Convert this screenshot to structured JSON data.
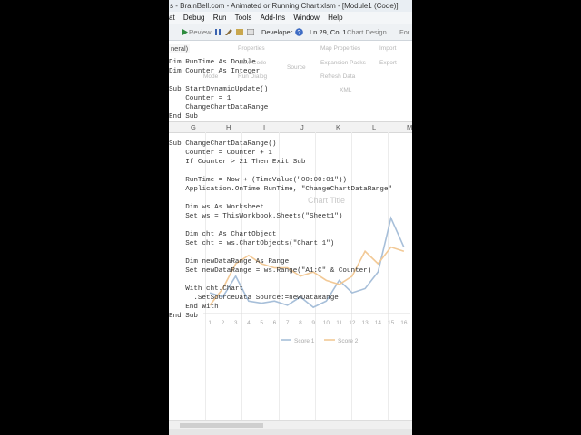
{
  "window": {
    "title": "s - BrainBell.com - Animated or Running Chart.xlsm - [Module1 (Code)]"
  },
  "menu": [
    "at",
    "Debug",
    "Run",
    "Tools",
    "Add-Ins",
    "Window",
    "Help"
  ],
  "toolbar": {
    "review_tab": "Review",
    "developer_tab": "Developer",
    "chart_design_tab": "Chart Design",
    "format_tab": "For",
    "cursor_pos": "Ln 29, Col 1"
  },
  "ribbon_ghost": [
    "Properties",
    "View Code",
    "Map Properties",
    "Import",
    "Mode",
    "Run Dialog",
    "Expansion Packs",
    "Export",
    "Source",
    "Refresh Data",
    "XML"
  ],
  "object_box": "neral)",
  "code_top": [
    "Dim RunTime As Double",
    "Dim Counter As Integer",
    "",
    "Sub StartDynamicUpdate()",
    "    Counter = 1",
    "    ChangeChartDataRange",
    "End Sub"
  ],
  "columns": [
    "G",
    "H",
    "I",
    "J",
    "K",
    "L",
    "M"
  ],
  "code_bottom": [
    "Sub ChangeChartDataRange()",
    "    Counter = Counter + 1",
    "    If Counter > 21 Then Exit Sub",
    "",
    "    RunTime = Now + (TimeValue(\"00:00:01\"))",
    "    Application.OnTime RunTime, \"ChangeChartDataRange\"",
    "",
    "    Dim ws As Worksheet",
    "    Set ws = ThisWorkbook.Sheets(\"Sheet1\")",
    "",
    "    Dim cht As ChartObject",
    "    Set cht = ws.ChartObjects(\"Chart 1\")",
    "",
    "    Dim newDataRange As Range",
    "    Set newDataRange = ws.Range(\"A1:C\" & Counter)",
    "",
    "    With cht.Chart",
    "      .SetSourceData Source:=newDataRange",
    "    End With",
    "End Sub"
  ],
  "chart_data": {
    "type": "line",
    "title": "Chart Title",
    "x": [
      1,
      2,
      3,
      4,
      5,
      6,
      7,
      8,
      9,
      10,
      11,
      12,
      13,
      14,
      15,
      16
    ],
    "series": [
      {
        "name": "Score 1",
        "color": "#a7bfd9",
        "values": [
          5,
          4,
          9,
          3,
          2.5,
          3,
          2,
          4,
          1.5,
          3,
          8,
          5,
          6,
          10,
          23,
          16
        ]
      },
      {
        "name": "Score 2",
        "color": "#f2c996",
        "values": [
          2,
          6,
          12,
          14,
          12,
          11,
          11,
          9,
          10,
          8,
          7,
          9,
          15,
          12,
          16,
          15
        ]
      }
    ],
    "ylim": [
      0,
      24
    ],
    "legend": "bottom",
    "grid": false
  }
}
